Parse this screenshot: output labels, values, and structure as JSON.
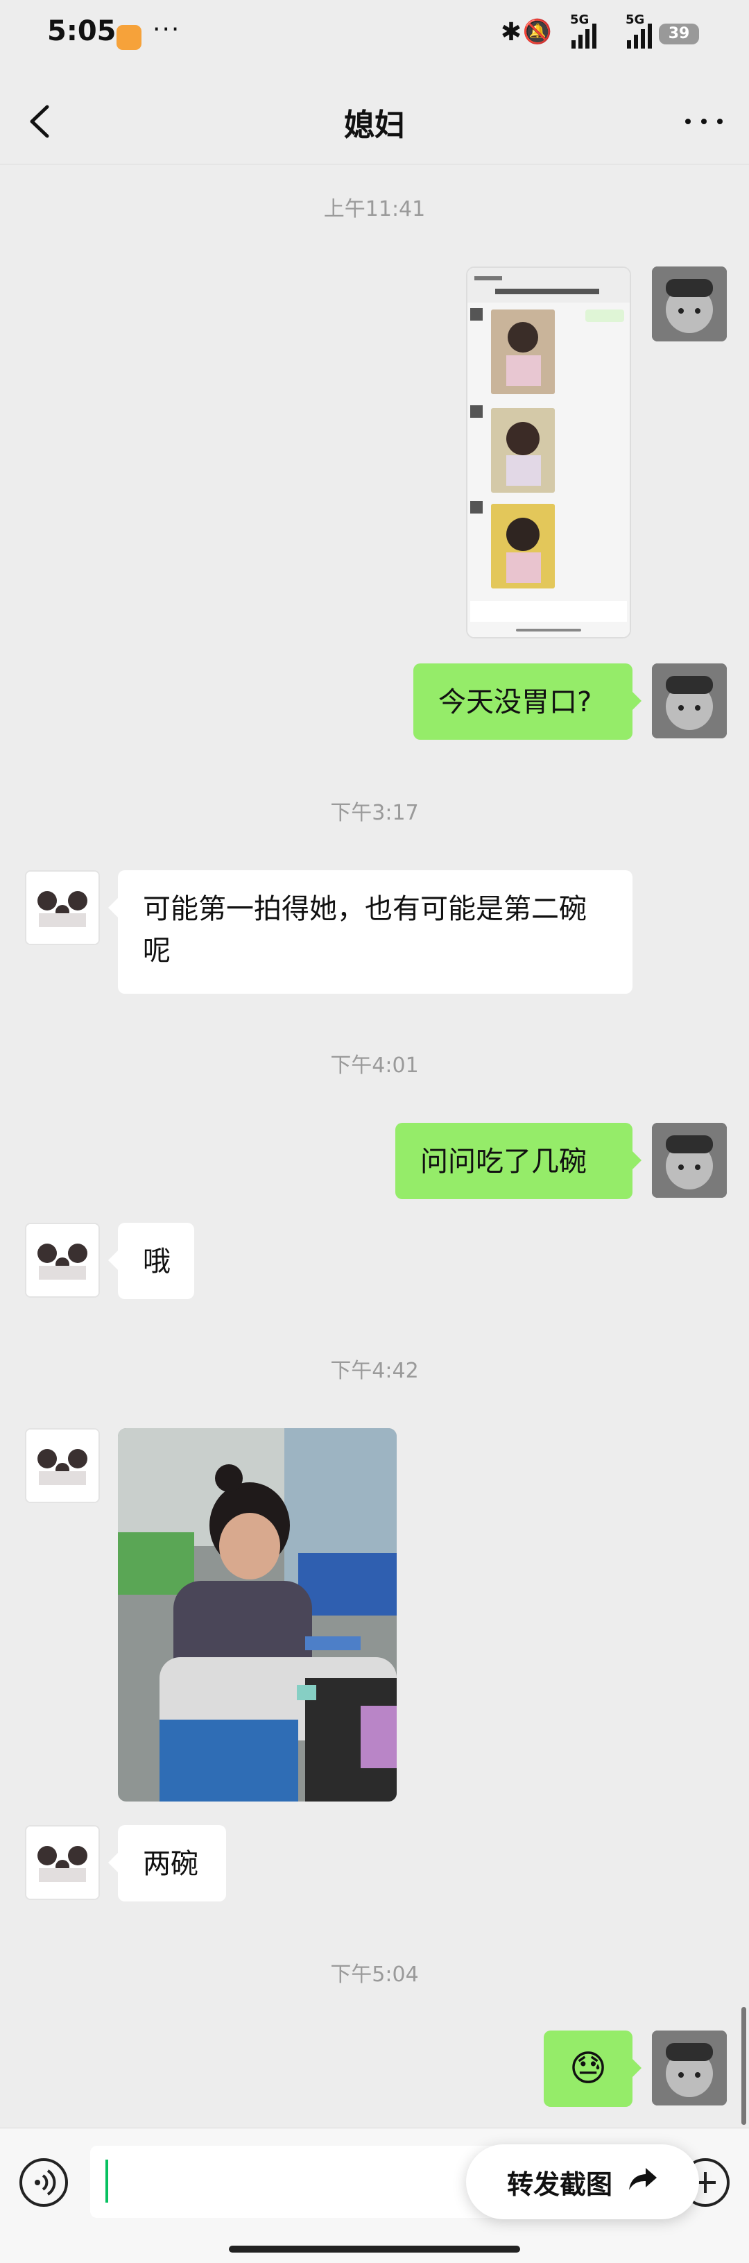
{
  "status": {
    "time": "5:05",
    "dots": "···",
    "network_1": "5G",
    "network_2": "5G",
    "battery": "39"
  },
  "nav": {
    "title": "媳妇"
  },
  "messages": {
    "time_1": "上午11:41",
    "time_2": "下午3:17",
    "time_3": "下午4:01",
    "time_4": "下午4:42",
    "time_5": "下午5:04",
    "me_1": "今天没胃口?",
    "wife_1": "可能第一拍得她，也有可能是第二碗呢",
    "me_2": "问问吃了几碗",
    "wife_2": "哦",
    "wife_3": "两碗",
    "me_emoji": "😓"
  },
  "input": {
    "forward_label": "转发截图"
  },
  "icons": [
    "back-icon",
    "more-icon",
    "bluetooth-icon",
    "mute-icon",
    "voice-icon",
    "plus-icon",
    "forward-arrow-icon"
  ],
  "colors": {
    "my_bubble": "#95ec69",
    "their_bubble": "#ffffff",
    "background": "#ededed",
    "caret": "#07c160"
  }
}
